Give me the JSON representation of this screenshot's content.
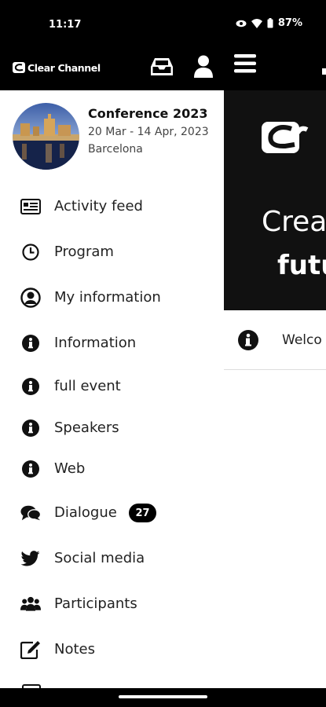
{
  "status_bar": {
    "time": "11:17",
    "battery": "87%"
  },
  "app_bar": {
    "brand": "Clear Channel"
  },
  "event": {
    "title": "Conference 2023",
    "dates": "20 Mar - 14 Apr, 2023",
    "city": "Barcelona"
  },
  "menu": [
    {
      "label": "Activity feed",
      "icon": "newspaper-icon"
    },
    {
      "label": "Program",
      "icon": "clock-icon"
    },
    {
      "label": "My information",
      "icon": "user-circle-icon"
    },
    {
      "label": "Information",
      "icon": "info-icon"
    },
    {
      "label": "full event",
      "icon": "info-icon"
    },
    {
      "label": "Speakers",
      "icon": "info-icon"
    },
    {
      "label": "Web",
      "icon": "info-icon"
    },
    {
      "label": "Dialogue",
      "icon": "comments-icon",
      "badge": "27"
    },
    {
      "label": "Social media",
      "icon": "twitter-icon"
    },
    {
      "label": "Participants",
      "icon": "users-icon"
    },
    {
      "label": "Notes",
      "icon": "edit-icon"
    }
  ],
  "background": {
    "hero_line1": "Crea",
    "hero_line2": "futu",
    "welcome": "Welco"
  }
}
